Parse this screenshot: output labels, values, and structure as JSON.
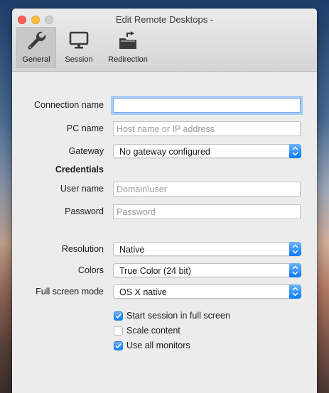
{
  "window": {
    "title": "Edit Remote Desktops -"
  },
  "toolbar": {
    "tabs": [
      {
        "label": "General",
        "icon": "wrench-icon",
        "selected": true
      },
      {
        "label": "Session",
        "icon": "monitor-icon",
        "selected": false
      },
      {
        "label": "Redirection",
        "icon": "folder-redirect-icon",
        "selected": false
      }
    ]
  },
  "form": {
    "connection_name": {
      "label": "Connection name",
      "value": ""
    },
    "pc_name": {
      "label": "PC name",
      "placeholder": "Host name or IP address",
      "value": ""
    },
    "gateway": {
      "label": "Gateway",
      "selected": "No gateway configured"
    },
    "credentials_heading": "Credentials",
    "user_name": {
      "label": "User name",
      "placeholder": "Domain\\user",
      "value": ""
    },
    "password": {
      "label": "Password",
      "placeholder": "Password",
      "value": ""
    },
    "resolution": {
      "label": "Resolution",
      "selected": "Native"
    },
    "colors": {
      "label": "Colors",
      "selected": "True Color (24 bit)"
    },
    "full_screen_mode": {
      "label": "Full screen mode",
      "selected": "OS X native"
    },
    "checkboxes": [
      {
        "label": "Start session in full screen",
        "checked": true
      },
      {
        "label": "Scale content",
        "checked": false
      },
      {
        "label": "Use all monitors",
        "checked": true
      }
    ]
  },
  "colors": {
    "accent": "#0a7bfd",
    "focus_ring": "#a8ccf6",
    "close": "#fc605c",
    "minimize": "#fdbc40"
  }
}
